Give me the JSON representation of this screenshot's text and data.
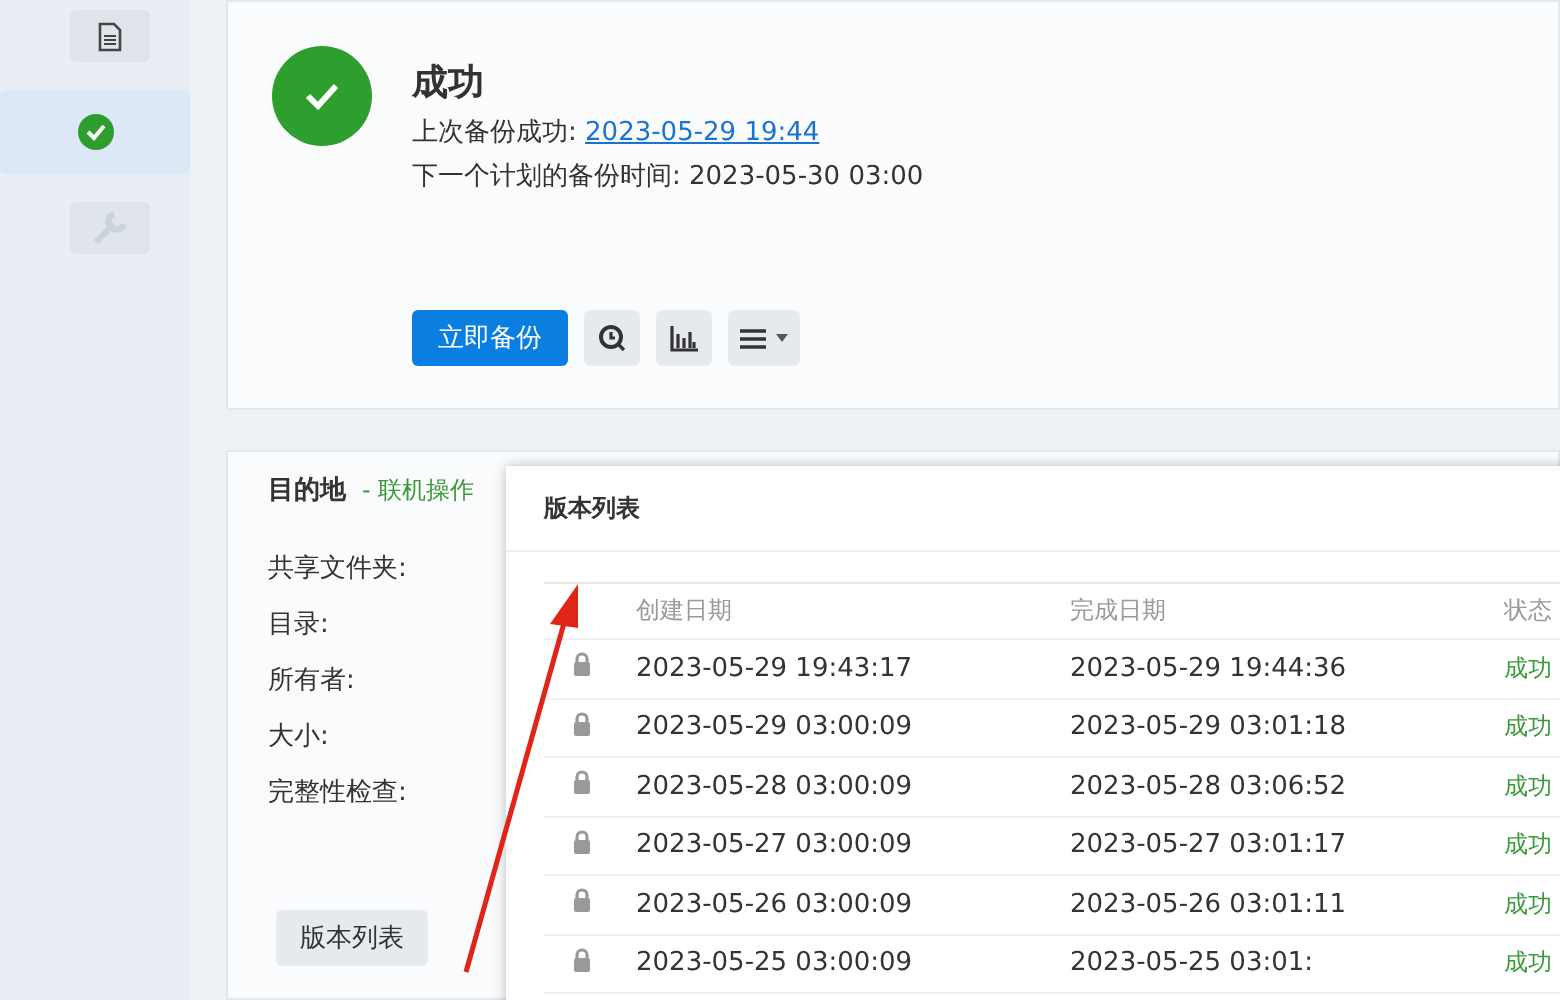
{
  "sidebar": {
    "items": [
      {
        "kind": "document",
        "selected": false
      },
      {
        "kind": "check",
        "selected": true
      },
      {
        "kind": "wrench",
        "selected": false
      }
    ]
  },
  "task": {
    "status": "成功",
    "last_backup_label": "上次备份成功:",
    "last_backup_link": "2023-05-29 19:44",
    "next_backup": "下一个计划的备份时间: 2023-05-30 03:00",
    "backup_now_button": "立即备份"
  },
  "destination": {
    "title": "目的地",
    "separator": "-",
    "status": "联机操作",
    "fields": [
      "共享文件夹:",
      "目录:",
      "所有者:",
      "大小:",
      "完整性检查:"
    ],
    "version_list_button": "版本列表"
  },
  "dialog": {
    "title": "版本列表",
    "columns": [
      "创建日期",
      "完成日期",
      "状态"
    ],
    "rows": [
      {
        "locked": true,
        "created": "2023-05-29 19:43:17",
        "finished": "2023-05-29 19:44:36",
        "status": "成功"
      },
      {
        "locked": true,
        "created": "2023-05-29 03:00:09",
        "finished": "2023-05-29 03:01:18",
        "status": "成功"
      },
      {
        "locked": true,
        "created": "2023-05-28 03:00:09",
        "finished": "2023-05-28 03:06:52",
        "status": "成功"
      },
      {
        "locked": true,
        "created": "2023-05-27 03:00:09",
        "finished": "2023-05-27 03:01:17",
        "status": "成功"
      },
      {
        "locked": true,
        "created": "2023-05-26 03:00:09",
        "finished": "2023-05-26 03:01:11",
        "status": "成功"
      },
      {
        "locked": true,
        "created": "2023-05-25 03:00:09",
        "finished": "2023-05-25 03:01:",
        "status": "成功"
      }
    ]
  }
}
